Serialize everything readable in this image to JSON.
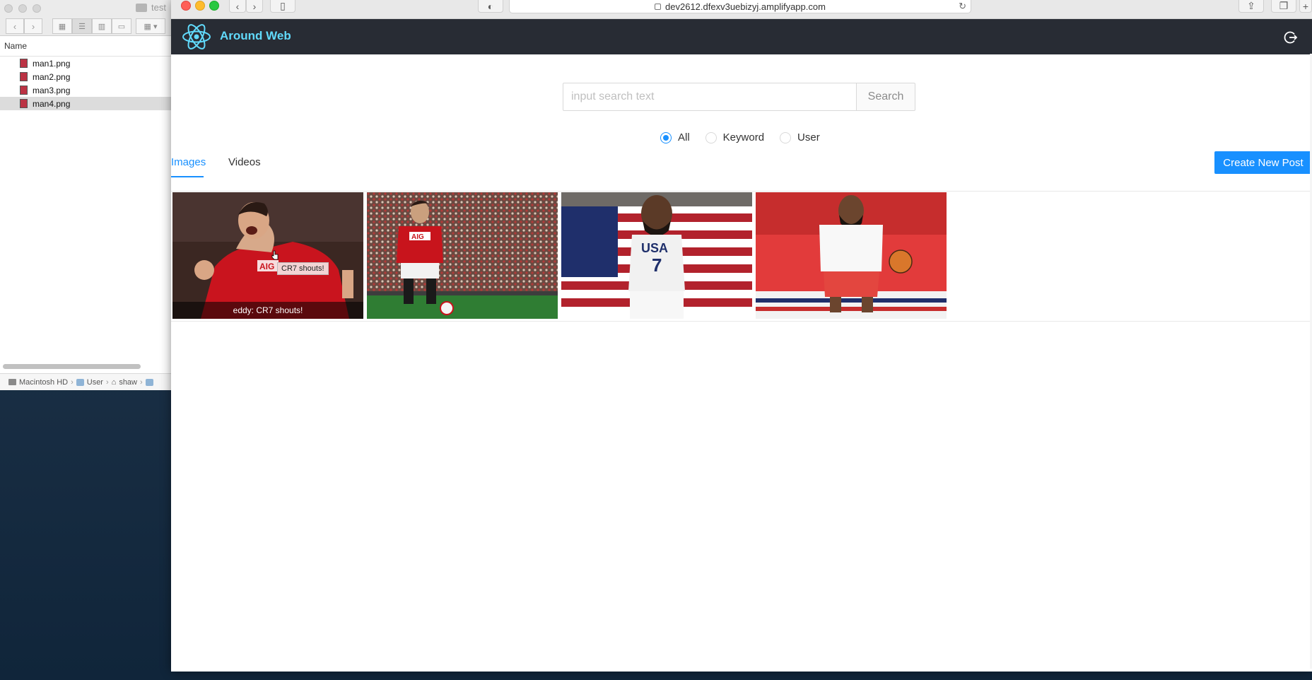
{
  "finder": {
    "title": "test",
    "column_header": "Name",
    "files": [
      {
        "name": "man1.png",
        "selected": false
      },
      {
        "name": "man2.png",
        "selected": false
      },
      {
        "name": "man3.png",
        "selected": false
      },
      {
        "name": "man4.png",
        "selected": true
      }
    ],
    "path": {
      "disk": "Macintosh HD",
      "users": "User",
      "home": "shaw"
    }
  },
  "browser": {
    "url": "dev2612.dfexv3uebizyj.amplifyapp.com"
  },
  "app": {
    "title": "Around Web",
    "brand_color": "#61dafb",
    "header_bg": "#282c34",
    "search": {
      "placeholder": "input search text",
      "value": "",
      "button_label": "Search"
    },
    "radios": [
      {
        "label": "All",
        "checked": true
      },
      {
        "label": "Keyword",
        "checked": false
      },
      {
        "label": "User",
        "checked": false
      }
    ],
    "tabs": [
      {
        "label": "Images",
        "active": true
      },
      {
        "label": "Videos",
        "active": false
      }
    ],
    "create_button": "Create New Post",
    "accent_color": "#1890ff",
    "photos": [
      {
        "caption": "eddy: CR7 shouts!",
        "tooltip": "CR7 shouts!",
        "subject": "player in red jersey shouting"
      },
      {
        "subject": "player in red jersey standing with ball"
      },
      {
        "subject": "basketball player with USA flag"
      },
      {
        "subject": "basketball player dribbling"
      }
    ]
  }
}
